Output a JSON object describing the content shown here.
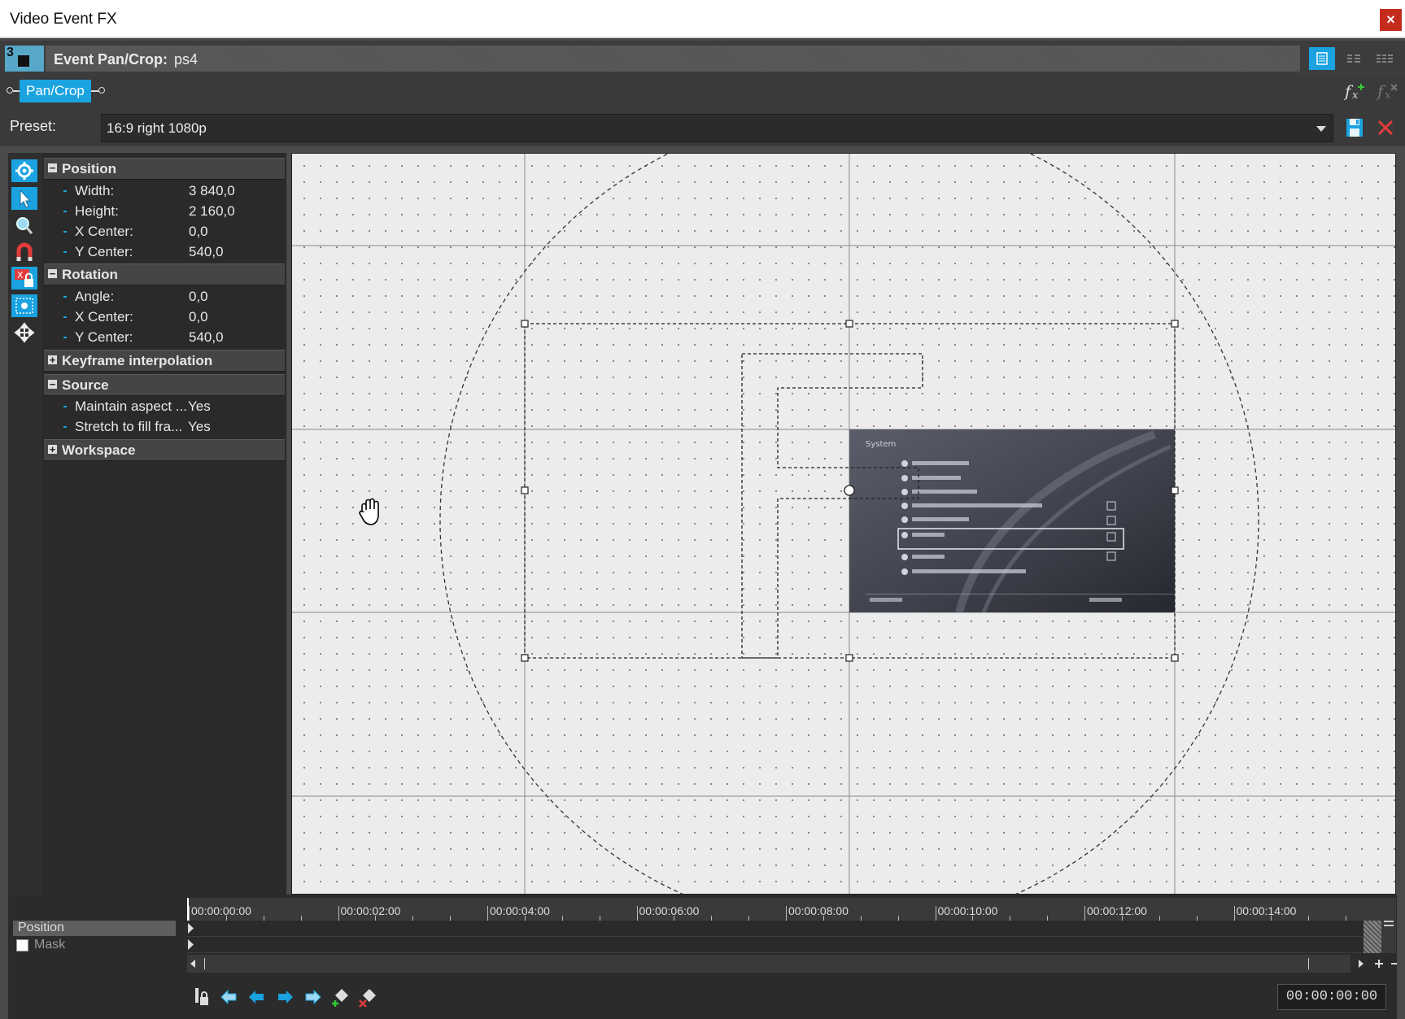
{
  "window": {
    "title": "Video Event FX",
    "close_glyph": "×"
  },
  "header": {
    "plugin_number": "3",
    "label": "Event Pan/Crop:",
    "event_name": "ps4"
  },
  "chain": {
    "plugin_tab": "Pan/Crop"
  },
  "preset": {
    "label": "Preset:",
    "value": "16:9 right 1080p"
  },
  "sections": {
    "position": {
      "title": "Position",
      "rows": [
        {
          "label": "Width:",
          "value": "3 840,0"
        },
        {
          "label": "Height:",
          "value": "2 160,0"
        },
        {
          "label": "X Center:",
          "value": "0,0"
        },
        {
          "label": "Y Center:",
          "value": "540,0"
        }
      ]
    },
    "rotation": {
      "title": "Rotation",
      "rows": [
        {
          "label": "Angle:",
          "value": "0,0"
        },
        {
          "label": "X Center:",
          "value": "0,0"
        },
        {
          "label": "Y Center:",
          "value": "540,0"
        }
      ]
    },
    "keyframe": {
      "title": "Keyframe interpolation"
    },
    "source": {
      "title": "Source",
      "rows": [
        {
          "label": "Maintain aspect ...",
          "value": "Yes"
        },
        {
          "label": "Stretch to fill fra...",
          "value": "Yes"
        }
      ]
    },
    "workspace": {
      "title": "Workspace"
    }
  },
  "preview": {
    "heading": "System"
  },
  "timeline": {
    "tracks": [
      "Position",
      "Mask"
    ],
    "ticks": [
      "00:00:00:00",
      "00:00:02:00",
      "00:00:04:00",
      "00:00:06:00",
      "00:00:08:00",
      "00:00:10:00",
      "00:00:12:00",
      "00:00:14:00"
    ],
    "timecode": "00:00:00:00"
  },
  "colors": {
    "accent": "#1aa3e0",
    "close": "#c42b1c",
    "canvas": "#ececec"
  },
  "icons": [
    "settings-icon",
    "arrow-cursor-icon",
    "zoom-icon",
    "magnet-icon",
    "lock-aspect-icon",
    "center-icon",
    "move-icon",
    "save-preset-icon",
    "delete-preset-icon",
    "fx-add-icon",
    "fx-remove-icon",
    "hand-cursor-icon"
  ]
}
